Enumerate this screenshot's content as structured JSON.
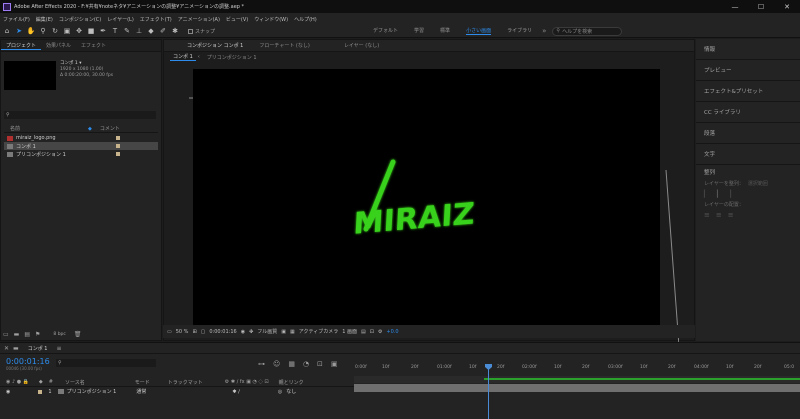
{
  "titlebar": {
    "title": "Adobe After Effects 2020 - F:¥共有¥noteネタ¥アニメーションの調整¥アニメーションの調整.aep *",
    "minimize": "—",
    "maximize": "☐",
    "close": "✕"
  },
  "menu": [
    "ファイル(F)",
    "編集(E)",
    "コンポジション(C)",
    "レイヤー(L)",
    "エフェクト(T)",
    "アニメーション(A)",
    "ビュー(V)",
    "ウィンドウ(W)",
    "ヘルプ(H)"
  ],
  "toolbar": {
    "snap_label": "スナップ",
    "workspaces": [
      "デフォルト",
      "学習",
      "標準",
      "小さい画面",
      "ライブラリ"
    ],
    "active_workspace": "小さい画面",
    "search_placeholder": "ヘルプを検索"
  },
  "project": {
    "tabs": [
      "プロジェクト",
      "効果パネル",
      "エフェクト"
    ],
    "selected_name": "コンポ 1 ▾",
    "selected_size": "1920 x 1080 (1.00)",
    "selected_duration": "Δ 0:00:20:00, 30.00 fps",
    "col_name": "名前",
    "col_comment": "コメント",
    "items": [
      {
        "name": "miraiz_logo.png",
        "type": "png"
      },
      {
        "name": "コンポ 1",
        "type": "comp",
        "selected": true
      },
      {
        "name": "プリコンポジション 1",
        "type": "comp"
      }
    ],
    "bpc": "8 bpc"
  },
  "composition": {
    "tabs": [
      "コンポジション コンポ 1",
      "フローチャート (なし)",
      "レイヤー (なし)"
    ],
    "breadcrumbs": [
      "コンポ 1",
      "プリコンポジション 1"
    ],
    "logo_text": "MIRAIZ",
    "viewer": {
      "zoom": "50 %",
      "timecode": "0:00:01:16",
      "resolution": "フル画質",
      "camera": "アクティブカメラ",
      "views": "1 画面",
      "exposure": "+0.0"
    }
  },
  "right_panels": {
    "items": [
      "情報",
      "プレビュー",
      "エフェクト&プリセット",
      "CC ライブラリ",
      "段落",
      "文字",
      "整列"
    ],
    "align_to_label": "レイヤーを整列：",
    "align_to_value": "選択範囲",
    "distribute_label": "レイヤーの配置："
  },
  "timeline": {
    "comp_tab": "コンポ 1",
    "timecode": "0:00:01:16",
    "frame_info": "00046 (30.00 fps)",
    "columns": {
      "source": "ソース名",
      "mode": "モード",
      "trkmat": "トラックマット",
      "parent": "親とリンク"
    },
    "ruler": [
      "0:00f",
      "10f",
      "20f",
      "01:00f",
      "10f",
      "20f",
      "02:00f",
      "10f",
      "20f",
      "03:00f",
      "10f",
      "20f",
      "04:00f",
      "10f",
      "20f",
      "05:0"
    ],
    "layers": [
      {
        "num": "1",
        "name": "プリコンポジション 1",
        "mode": "通常",
        "parent": "なし"
      }
    ]
  },
  "colors": {
    "accent": "#2d8ceb",
    "logo_green": "#39d21a",
    "panel_bg": "#232323"
  }
}
